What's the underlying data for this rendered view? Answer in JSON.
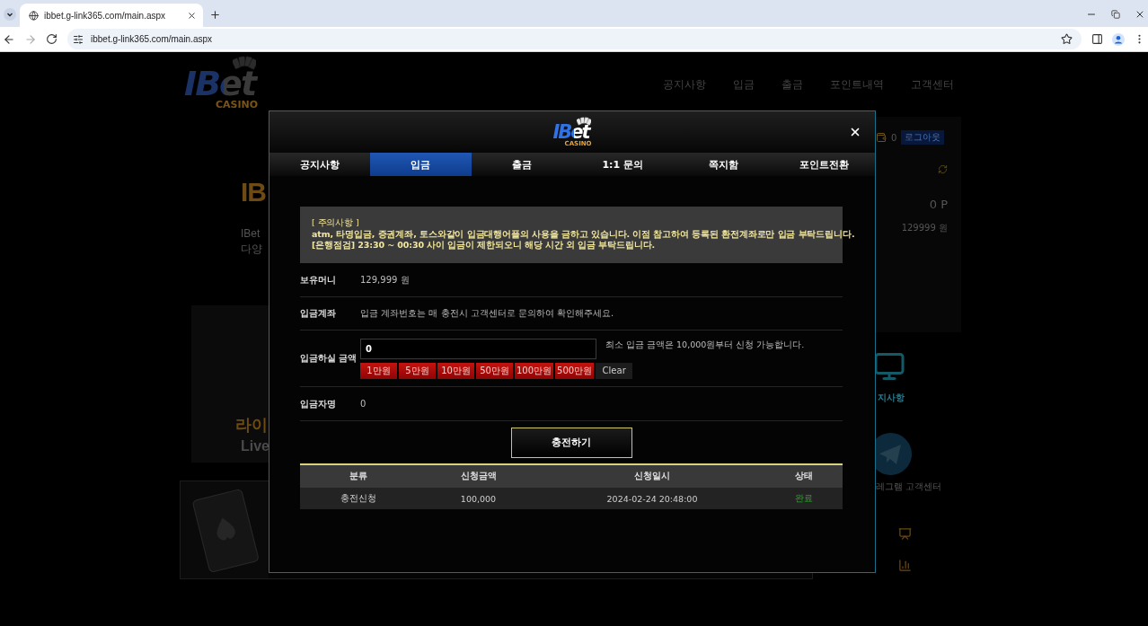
{
  "browser": {
    "tab_title": "ibbet.g-link365.com/main.aspx",
    "url": "ibbet.g-link365.com/main.aspx"
  },
  "site": {
    "logo": {
      "word": "IBet",
      "sub": "CASINO"
    },
    "nav": [
      "공지사항",
      "입금",
      "출금",
      "포인트내역",
      "고객센터"
    ],
    "hero": {
      "title": "IB",
      "lines": [
        "IBet",
        "다양"
      ]
    },
    "wallet": {
      "coins": "0",
      "logout": "로그아웃",
      "points": "0 P",
      "money": "129999 원"
    },
    "live_banner": {
      "title": "라이",
      "subtitle": "Live"
    },
    "notice_link": "지사항",
    "telegram": "레그램 고객센터"
  },
  "modal": {
    "logo": {
      "word": "IBet",
      "sub": "CASINO"
    },
    "tabs": [
      {
        "label": "공지사항",
        "selected": false
      },
      {
        "label": "입금",
        "selected": true
      },
      {
        "label": "출금",
        "selected": false
      },
      {
        "label": "1:1 문의",
        "selected": false
      },
      {
        "label": "쪽지함",
        "selected": false
      },
      {
        "label": "포인트전환",
        "selected": false
      }
    ],
    "notice": [
      "[ 주의사항 ]",
      "atm, 타명입금, 증권계좌, 토스와같이 입금대행어플의 사용을 금하고 있습니다. 이점 참고하여 등록된 환전계좌로만 입금 부탁드립니다.",
      "[은행점검] 23:30 ~ 00:30 사이 입금이 제한되오니 해당 시간 외 입금 부탁드립니다."
    ],
    "fields": [
      {
        "kind": "text",
        "label": "보유머니",
        "value": "129,999 원"
      },
      {
        "kind": "text",
        "label": "입금계좌",
        "value": "입금 계좌번호는 매 충전시 고객센터로 문의하여 확인해주세요."
      },
      {
        "kind": "amount",
        "label": "입금하실 금액",
        "value": "0",
        "hint": "최소 입금 금액은 10,000원부터 신청 가능합니다.",
        "quick_amounts": [
          "1만원",
          "5만원",
          "10만원",
          "50만원",
          "100만원",
          "500만원"
        ],
        "clear": "Clear"
      },
      {
        "kind": "text",
        "label": "입금자명",
        "value": "0"
      }
    ],
    "submit": "충전하기",
    "history": {
      "columns": [
        "분류",
        "신청금액",
        "신청일시",
        "상태"
      ],
      "rows": [
        [
          "충전신청",
          "100,000",
          "2024-02-24 20:48:00",
          "완료"
        ]
      ]
    }
  }
}
